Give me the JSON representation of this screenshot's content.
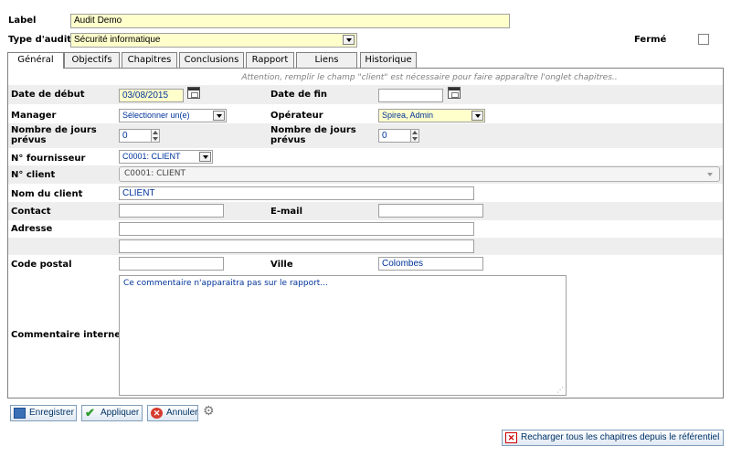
{
  "header": {
    "label_caption": "Label",
    "label_value": "Audit Demo",
    "type_caption": "Type d'audit",
    "type_value": "Sécurité informatique",
    "closed_caption": "Fermé"
  },
  "tabs": [
    {
      "label": "Général"
    },
    {
      "label": "Objectifs"
    },
    {
      "label": "Chapitres"
    },
    {
      "label": "Conclusions"
    },
    {
      "label": "Rapport"
    },
    {
      "label": "Liens"
    },
    {
      "label": "Historique"
    }
  ],
  "notice": "Attention, remplir le champ \"client\" est nécessaire pour faire apparaître l'onglet chapitres..",
  "form": {
    "start_date_label": "Date de début",
    "start_date_value": "03/08/2015",
    "end_date_label": "Date de fin",
    "end_date_value": "",
    "manager_label": "Manager",
    "manager_value": "Sélectionner un(e)",
    "operator_label": "Opérateur",
    "operator_value": "Spirea, Admin",
    "planned_days_label": "Nombre de jours prévus",
    "planned_days_value": "0",
    "planned_days_label_2": "Nombre de jours prévus",
    "planned_days_value_2": "0",
    "supplier_label": "N° fournisseur",
    "supplier_value": "C0001: CLIENT",
    "client_no_label": "N° client",
    "client_no_value": "C0001: CLIENT",
    "client_name_label": "Nom du client",
    "client_name_value": "CLIENT",
    "contact_label": "Contact",
    "contact_value": "",
    "email_label": "E-mail",
    "email_value": "",
    "address_label": "Adresse",
    "address_line1": "",
    "address_line2": "",
    "postal_label": "Code postal",
    "postal_value": "",
    "city_label": "Ville",
    "city_value": "Colombes",
    "comment_label": "Commentaire interne",
    "comment_value": "Ce commentaire n'apparaitra pas sur le rapport..."
  },
  "buttons": {
    "save": "Enregistrer",
    "apply": "Appliquer",
    "cancel": "Annuler",
    "reload": "Recharger tous les chapitres depuis le référentiel"
  },
  "colors": {
    "yellow_field": "#ffffcc",
    "row_band": "#eeeeee",
    "accent_text": "#003399"
  }
}
